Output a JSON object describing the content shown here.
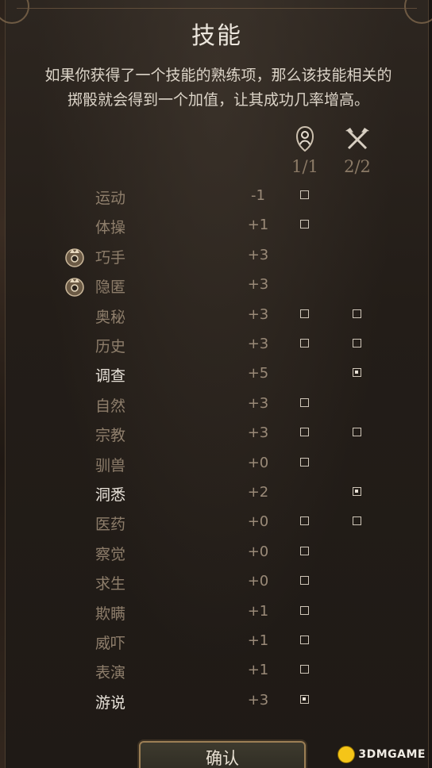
{
  "title": "技能",
  "description_line1": "如果你获得了一个技能的熟练项，那么该技能相关的",
  "description_line2": "掷骰就会得到一个加值，让其成功几率增高。",
  "columns": [
    {
      "icon": "character-portrait-icon",
      "count": "1/1"
    },
    {
      "icon": "crossed-tools-icon",
      "count": "2/2"
    }
  ],
  "skills": [
    {
      "name": "运动",
      "value": "-1",
      "col1": "unchecked",
      "col2": "none",
      "badge": false,
      "highlight": false
    },
    {
      "name": "体操",
      "value": "+1",
      "col1": "unchecked",
      "col2": "none",
      "badge": false,
      "highlight": false
    },
    {
      "name": "巧手",
      "value": "+3",
      "col1": "none",
      "col2": "none",
      "badge": true,
      "highlight": false
    },
    {
      "name": "隐匿",
      "value": "+3",
      "col1": "none",
      "col2": "none",
      "badge": true,
      "highlight": false
    },
    {
      "name": "奥秘",
      "value": "+3",
      "col1": "unchecked",
      "col2": "unchecked",
      "badge": false,
      "highlight": false
    },
    {
      "name": "历史",
      "value": "+3",
      "col1": "unchecked",
      "col2": "unchecked",
      "badge": false,
      "highlight": false
    },
    {
      "name": "调查",
      "value": "+5",
      "col1": "none",
      "col2": "checked",
      "badge": false,
      "highlight": true
    },
    {
      "name": "自然",
      "value": "+3",
      "col1": "unchecked",
      "col2": "none",
      "badge": false,
      "highlight": false
    },
    {
      "name": "宗教",
      "value": "+3",
      "col1": "unchecked",
      "col2": "unchecked",
      "badge": false,
      "highlight": false
    },
    {
      "name": "驯兽",
      "value": "+0",
      "col1": "unchecked",
      "col2": "none",
      "badge": false,
      "highlight": false
    },
    {
      "name": "洞悉",
      "value": "+2",
      "col1": "none",
      "col2": "checked",
      "badge": false,
      "highlight": true
    },
    {
      "name": "医药",
      "value": "+0",
      "col1": "unchecked",
      "col2": "unchecked",
      "badge": false,
      "highlight": false
    },
    {
      "name": "察觉",
      "value": "+0",
      "col1": "unchecked",
      "col2": "none",
      "badge": false,
      "highlight": false
    },
    {
      "name": "求生",
      "value": "+0",
      "col1": "unchecked",
      "col2": "none",
      "badge": false,
      "highlight": false
    },
    {
      "name": "欺瞒",
      "value": "+1",
      "col1": "unchecked",
      "col2": "none",
      "badge": false,
      "highlight": false
    },
    {
      "name": "威吓",
      "value": "+1",
      "col1": "unchecked",
      "col2": "none",
      "badge": false,
      "highlight": false
    },
    {
      "name": "表演",
      "value": "+1",
      "col1": "unchecked",
      "col2": "none",
      "badge": false,
      "highlight": false
    },
    {
      "name": "游说",
      "value": "+3",
      "col1": "checked",
      "col2": "none",
      "badge": false,
      "highlight": true
    }
  ],
  "confirm_label": "确认",
  "watermark": "3DMGAME"
}
